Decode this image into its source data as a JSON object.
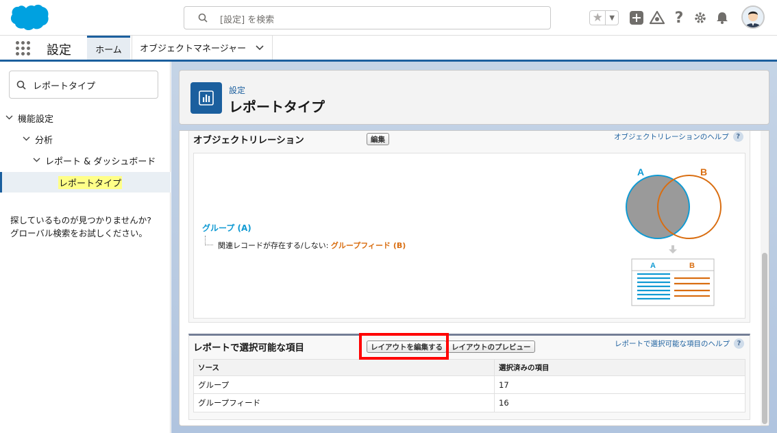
{
  "header": {
    "search_placeholder": "[設定] を検索",
    "icons": [
      "favorites-star-icon",
      "add-icon",
      "trailhead-icon",
      "help-icon",
      "gear-icon",
      "notification-bell-icon",
      "avatar"
    ]
  },
  "nav": {
    "app_name": "設定",
    "tabs": [
      {
        "label": "ホーム",
        "active": true
      },
      {
        "label": "オブジェクトマネージャー",
        "active": false
      }
    ]
  },
  "sidebar": {
    "quick_find_value": "レポートタイプ",
    "tree": [
      {
        "label": "機能設定",
        "level": 0
      },
      {
        "label": "分析",
        "level": 1
      },
      {
        "label": "レポート & ダッシュボード",
        "level": 2
      },
      {
        "label": "レポートタイプ",
        "level": 3,
        "selected": true
      }
    ],
    "no_match_line1": "探しているものが見つかりませんか?",
    "no_match_line2": "グローバル検索をお試しください。"
  },
  "page_header": {
    "subtitle": "設定",
    "title": "レポートタイプ"
  },
  "object_relation": {
    "title": "オブジェクトリレーション",
    "edit_button": "編集",
    "help_link": "オブジェクトリレーションのヘルプ",
    "group_a": "グループ (A)",
    "relation_text": "関連レコードが存在する/しない:",
    "group_b": "グループフィード (B)",
    "venn_label_a": "A",
    "venn_label_b": "B",
    "table_label_a": "A",
    "table_label_b": "B"
  },
  "fields_section": {
    "title": "レポートで選択可能な項目",
    "edit_layout_button": "レイアウトを編集する",
    "preview_layout_button": "レイアウトのプレビュー",
    "help_link": "レポートで選択可能な項目のヘルプ",
    "columns": [
      "ソース",
      "選択済みの項目"
    ],
    "rows": [
      {
        "source": "グループ",
        "count": "17"
      },
      {
        "source": "グループフィード",
        "count": "16"
      }
    ]
  },
  "colors": {
    "brand": "#1b5f9e",
    "group_a": "#0f9ad3",
    "group_b": "#d96d10",
    "highlight": "#ff0000"
  }
}
